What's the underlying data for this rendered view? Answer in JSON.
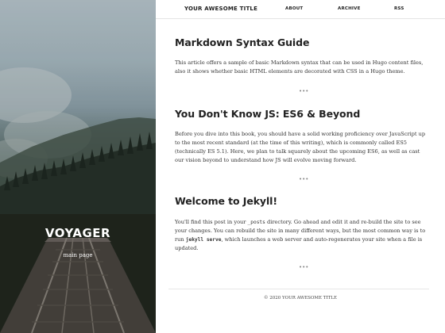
{
  "hero": {
    "title": "VOYAGER",
    "subtitle": "main page"
  },
  "nav": {
    "site_title": "YOUR AWESOME TITLE",
    "links": [
      "ABOUT",
      "ARCHIVE",
      "RSS"
    ]
  },
  "posts": [
    {
      "title": "Markdown Syntax Guide",
      "summary": "This article offers a sample of basic Markdown syntax that can be used in Hugo content files, also it shows whether basic HTML elements are decorated with CSS in a Hugo theme."
    },
    {
      "title": "You Don't Know JS: ES6 & Beyond",
      "summary": "Before you dive into this book, you should have a solid working proficiency over JavaScript up to the most recent standard (at the time of this writing), which is commonly called ES5 (technically ES 5.1). Here, we plan to talk squarely about the upcoming ES6, as well as cast our vision beyond to understand how JS will evolve moving forward."
    },
    {
      "title": "Welcome to Jekyll!",
      "summary_parts": {
        "a": "You'll find this post in your ",
        "code1": "_posts",
        "b": " directory. Go ahead and edit it and re-build the site to see your changes. You can rebuild the site in many different ways, but the most common way is to run ",
        "code2": "jekyll serve",
        "c": ", which launches a web server and auto-regenerates your site when a file is updated."
      }
    }
  ],
  "separator": "•••",
  "footer": "© 2020 YOUR AWESOME TITLE"
}
